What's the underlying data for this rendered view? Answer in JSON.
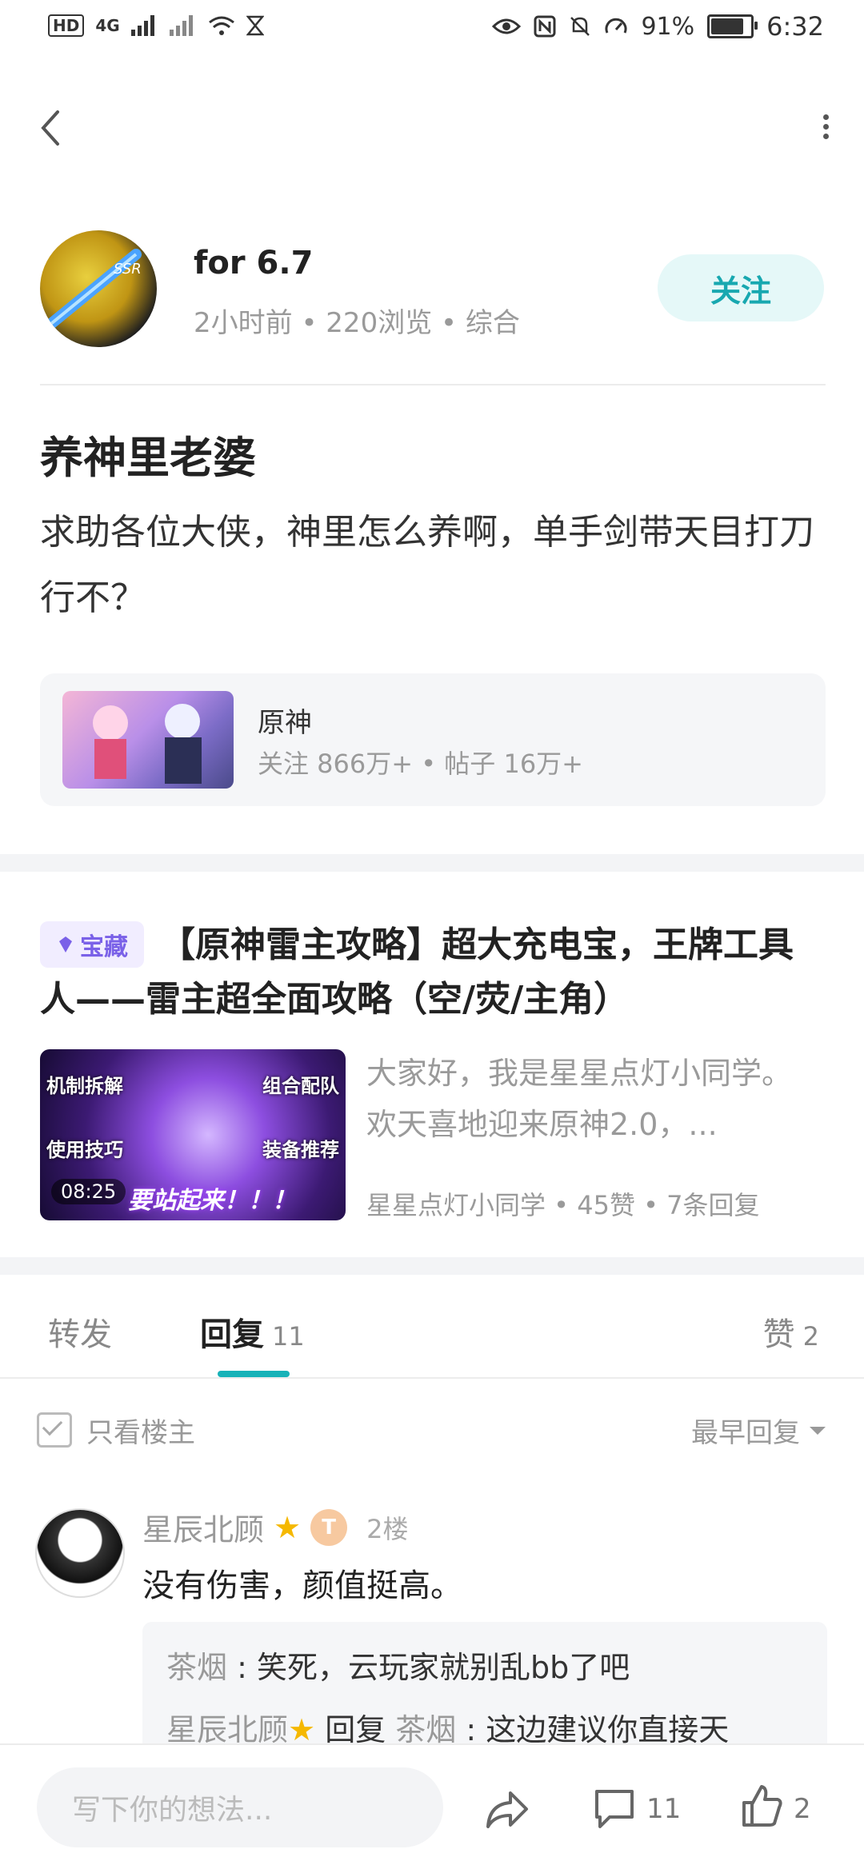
{
  "status_bar": {
    "hd": "HD",
    "network": "4G",
    "battery": "91%",
    "battery_level": 0.91,
    "time": "6:32"
  },
  "author": {
    "name": "for 6.7",
    "meta": "2小时前 • 220浏览 • 综合",
    "follow_label": "关注"
  },
  "post": {
    "title": "养神里老婆",
    "body": "求助各位大侠，神里怎么养啊，单手剑带天目打刀行不？"
  },
  "forum": {
    "name": "原神",
    "stats": "关注 866万+ • 帖子 16万+"
  },
  "recommended": {
    "tag": "宝藏",
    "title": "【原神雷主攻略】超大充电宝，王牌工具人——雷主超全面攻略（空/荧/主角）",
    "thumb_labels": [
      "机制拆解",
      "组合配队",
      "使用技巧",
      "装备推荐"
    ],
    "thumb_banner": "要站起来！！！",
    "duration": "08:25",
    "summary": "大家好，我是星星点灯小同学。欢天喜地迎来原神2.0，...",
    "meta": "星星点灯小同学 • 45赞 • 7条回复"
  },
  "tabs": {
    "forward": "转发",
    "reply": "回复",
    "reply_count": "11",
    "like": "赞",
    "like_count": "2"
  },
  "filter": {
    "only_owner": "只看楼主",
    "sort": "最早回复"
  },
  "reply": {
    "user": "星辰北顾",
    "level": "T",
    "floor": "2楼",
    "text": "没有伤害，颜值挺高。",
    "sub_replies": [
      {
        "user": "茶烟",
        "sep": " : ",
        "text": "笑死，云玩家就别乱bb了吧"
      },
      {
        "user": "星辰北顾",
        "action": "回复",
        "target": "茶烟",
        "sep": " : ",
        "text": "这边建议你直接天"
      }
    ]
  },
  "bottom_bar": {
    "placeholder": "写下你的想法...",
    "comment_count": "11",
    "like_count": "2"
  },
  "colors": {
    "accent": "#18b2b8",
    "follow_bg": "#e5f8f8",
    "treasure": "#7a61e8",
    "muted": "#9a9a9a"
  }
}
